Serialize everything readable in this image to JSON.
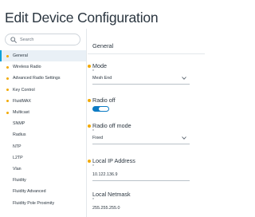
{
  "header": {
    "title": "Edit Device Configuration"
  },
  "search": {
    "placeholder": "Search",
    "icon": "search-icon"
  },
  "sidebar": {
    "items": [
      {
        "label": "General",
        "active": true,
        "marked": true
      },
      {
        "label": "Wireless Radio",
        "active": false,
        "marked": true
      },
      {
        "label": "Advanced Radio Settings",
        "active": false,
        "marked": true
      },
      {
        "label": "Key Control",
        "active": false,
        "marked": true
      },
      {
        "label": "FluidMAX",
        "active": false,
        "marked": true
      },
      {
        "label": "Multicast",
        "active": false,
        "marked": true
      },
      {
        "label": "SNMP",
        "active": false,
        "marked": false
      },
      {
        "label": "Radius",
        "active": false,
        "marked": false
      },
      {
        "label": "NTP",
        "active": false,
        "marked": false
      },
      {
        "label": "L2TP",
        "active": false,
        "marked": false
      },
      {
        "label": "Vlan",
        "active": false,
        "marked": false
      },
      {
        "label": "Fluidity",
        "active": false,
        "marked": false
      },
      {
        "label": "Fluidity Advanced",
        "active": false,
        "marked": false
      },
      {
        "label": "Fluidity Pole Proximity",
        "active": false,
        "marked": false
      }
    ]
  },
  "main": {
    "section_title": "General",
    "mode": {
      "label": "Mode",
      "sub": "*",
      "value": "Mesh End"
    },
    "radio_off": {
      "label": "Radio off",
      "enabled": true
    },
    "radio_off_mode": {
      "label": "Radio off mode",
      "sub": "*",
      "value": "Fixed"
    },
    "local_ip": {
      "label": "Local IP Address",
      "sub": "*",
      "value": "10.122.136.9"
    },
    "local_netmask": {
      "label": "Local Netmask",
      "sub": "*",
      "value": "255.255.255.0"
    }
  },
  "colors": {
    "accent": "#049fd9",
    "toggle": "#0d7bc4",
    "marker": "#f2a900",
    "active_bg": "#e9f0f6"
  }
}
